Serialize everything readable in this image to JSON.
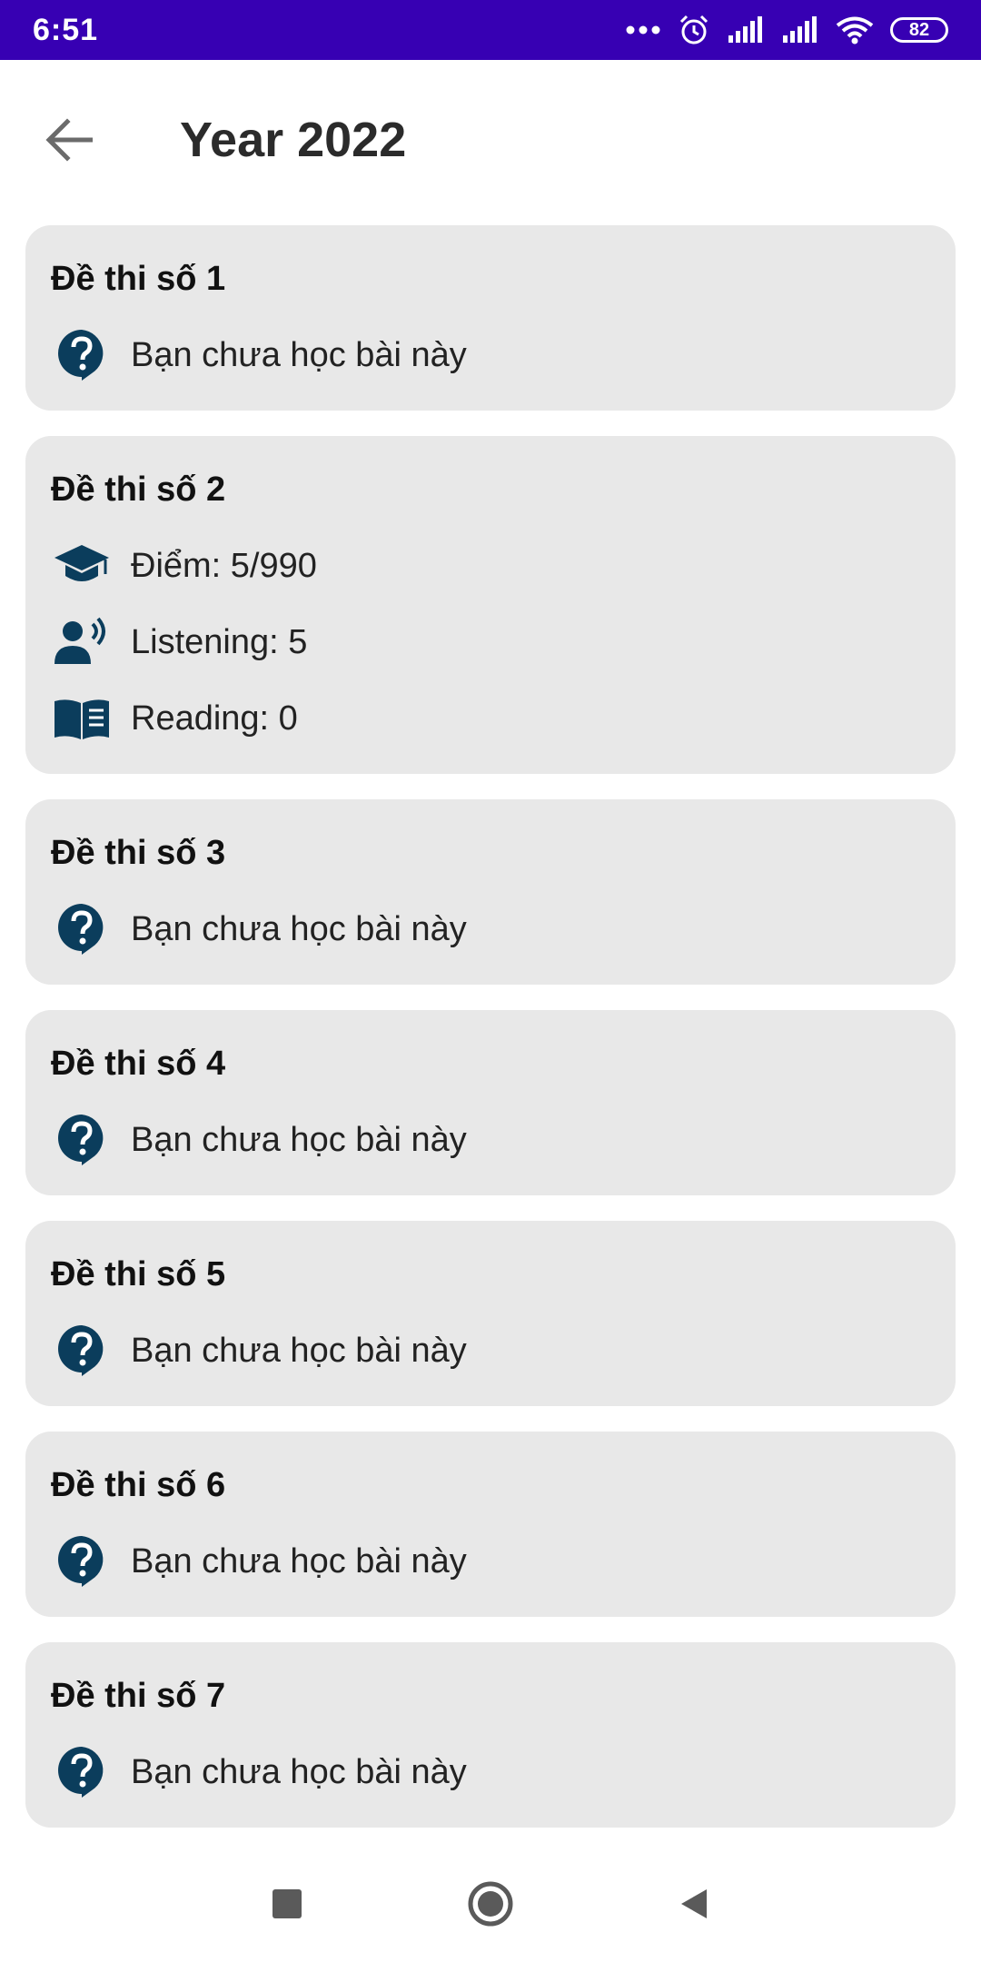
{
  "status_bar": {
    "time": "6:51",
    "battery": "82",
    "color": "#3700b3"
  },
  "header": {
    "title": "Year 2022",
    "back_icon": "arrow-left-icon"
  },
  "tests": [
    {
      "title": "Đề thi số 1",
      "status": "Bạn chưa học bài này"
    },
    {
      "title": "Đề thi số 2",
      "score": "Điểm: 5/990",
      "listening": "Listening: 5",
      "reading": "Reading: 0"
    },
    {
      "title": "Đề thi số 3",
      "status": "Bạn chưa học bài này"
    },
    {
      "title": "Đề thi số 4",
      "status": "Bạn chưa học bài này"
    },
    {
      "title": "Đề thi số 5",
      "status": "Bạn chưa học bài này"
    },
    {
      "title": "Đề thi số 6",
      "status": "Bạn chưa học bài này"
    },
    {
      "title": "Đề thi số 7",
      "status": "Bạn chưa học bài này"
    }
  ],
  "icons": {
    "unlearned": "help-bubble-icon",
    "score": "graduation-cap-icon",
    "listening": "speaker-person-icon",
    "reading": "book-icon"
  },
  "colors": {
    "icon": "#0b3d5c",
    "card_bg": "#e8e8e8",
    "accent": "#3700b3"
  },
  "nav_bar": {
    "buttons": [
      "recents-icon",
      "home-icon",
      "back-icon"
    ]
  }
}
